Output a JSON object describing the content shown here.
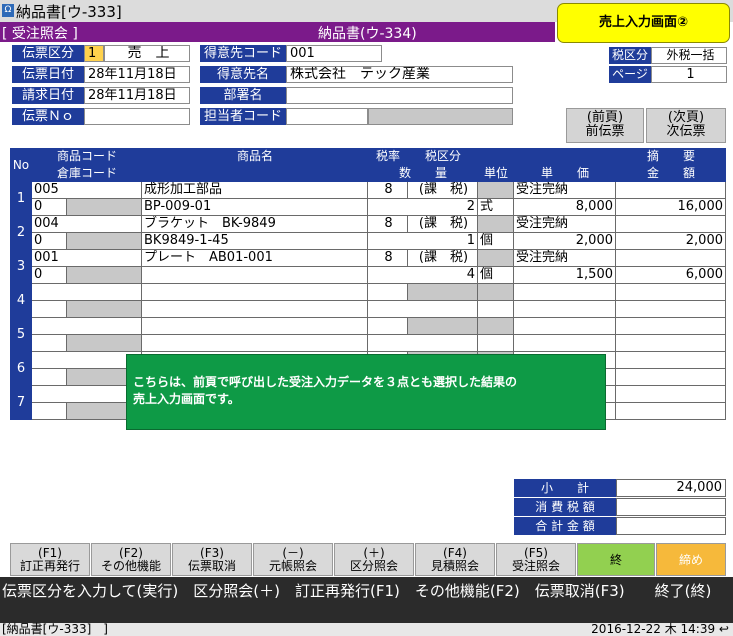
{
  "window": {
    "title": "納品書[ウ-333]",
    "icon": "app-icon"
  },
  "callout": "売上入力画面②",
  "modebar": {
    "mode": "[ 受注照会 ]",
    "doc": "納品書(ウ-334)"
  },
  "header": {
    "denpyo_kubun_label": "伝票区分",
    "denpyo_kubun_code": "1",
    "denpyo_kubun_value": "売　上",
    "denpyo_date_label": "伝票日付",
    "denpyo_date_value": "28年11月18日",
    "seikyu_date_label": "請求日付",
    "seikyu_date_value": "28年11月18日",
    "denpyo_no_label": "伝票Ｎｏ",
    "denpyo_no_value": "",
    "customer_code_label": "得意先コード",
    "customer_code_value": "001",
    "customer_name_label": "得意先名",
    "customer_name_value": "株式会社　テック産業",
    "dept_label": "部署名",
    "dept_value": "",
    "staff_code_label": "担当者コード",
    "staff_code_value": "",
    "tax_kind_label": "税区分",
    "tax_kind_value": "外税一括",
    "page_label": "ページ",
    "page_value": "1"
  },
  "nav": {
    "prev": [
      "(前頁)",
      "前伝票"
    ],
    "next": [
      "(次頁)",
      "次伝票"
    ]
  },
  "grid": {
    "headers": {
      "no": "No",
      "code": "商品コード",
      "warehouse": "倉庫コード",
      "name": "商品名",
      "tax_rate": "税率",
      "tax_kind": "税区分",
      "qty": "数　　量",
      "unit": "単位",
      "price": "単　　価",
      "memo": "摘　　要",
      "amount": "金　　額"
    },
    "rows": [
      {
        "no": "1",
        "code": "005",
        "warehouse": "0",
        "name": "成形加工部品",
        "name2": "BP-009-01",
        "tax_rate": "8",
        "tax_kind": "(課　税)",
        "qty": "2",
        "unit": "式",
        "status": "受注完納",
        "price": "8,000",
        "amount": "16,000"
      },
      {
        "no": "2",
        "code": "004",
        "warehouse": "0",
        "name": "ブラケット　BK-9849",
        "name2": "BK9849-1-45",
        "tax_rate": "8",
        "tax_kind": "(課　税)",
        "qty": "1",
        "unit": "個",
        "status": "受注完納",
        "price": "2,000",
        "amount": "2,000"
      },
      {
        "no": "3",
        "code": "001",
        "warehouse": "0",
        "name": "プレート　AB01-001",
        "name2": "",
        "tax_rate": "8",
        "tax_kind": "(課　税)",
        "qty": "4",
        "unit": "個",
        "status": "受注完納",
        "price": "1,500",
        "amount": "6,000"
      },
      {
        "no": "4",
        "code": "",
        "warehouse": "",
        "name": "",
        "name2": "",
        "tax_rate": "",
        "tax_kind": "",
        "qty": "",
        "unit": "",
        "status": "",
        "price": "",
        "amount": ""
      },
      {
        "no": "5",
        "code": "",
        "warehouse": "",
        "name": "",
        "name2": "",
        "tax_rate": "",
        "tax_kind": "",
        "qty": "",
        "unit": "",
        "status": "",
        "price": "",
        "amount": ""
      },
      {
        "no": "6",
        "code": "",
        "warehouse": "",
        "name": "",
        "name2": "",
        "tax_rate": "",
        "tax_kind": "",
        "qty": "",
        "unit": "",
        "status": "",
        "price": "",
        "amount": ""
      },
      {
        "no": "7",
        "code": "",
        "warehouse": "",
        "name": "",
        "name2": "",
        "tax_rate": "",
        "tax_kind": "",
        "qty": "",
        "unit": "",
        "status": "",
        "price": "",
        "amount": ""
      }
    ]
  },
  "totals": {
    "subtotal_label": "小　　計",
    "subtotal_value": "24,000",
    "tax_label": "消 費 税 額",
    "tax_value": "",
    "total_label": "合 計 金 額",
    "total_value": ""
  },
  "note": [
    "こちらは、前頁で呼び出した受注入力データを３点とも選択した結果の",
    "売上入力画面です。"
  ],
  "fkeys": [
    {
      "key": "(F1)",
      "label": "訂正再発行"
    },
    {
      "key": "(F2)",
      "label": "その他機能"
    },
    {
      "key": "(F3)",
      "label": "伝票取消"
    },
    {
      "key": "(－)",
      "label": "元帳照会"
    },
    {
      "key": "(＋)",
      "label": "区分照会"
    },
    {
      "key": "(F4)",
      "label": "見積照会"
    },
    {
      "key": "(F5)",
      "label": "受注照会"
    },
    {
      "key": "",
      "label": "終"
    },
    {
      "key": "",
      "label": "締め"
    }
  ],
  "message": "伝票区分を入力して(実行)　区分照会(＋)　訂正再発行(F1)　その他機能(F2)　伝票取消(F3)　　終了(終)",
  "status": {
    "left": "[納品書[ウ-333]　]",
    "right": "2016-12-22 木 14:39 ↩"
  },
  "colors": {
    "label_blue": "#1f3c9a",
    "mode_purple": "#7b1a8a",
    "note_green": "#0e9a46",
    "callout_yellow": "#ffff00"
  }
}
